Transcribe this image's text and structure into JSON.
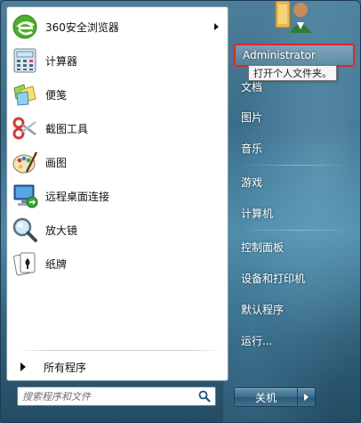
{
  "programs": [
    {
      "label": "360安全浏览器",
      "icon": "browser-icon",
      "has_submenu": true
    },
    {
      "label": "计算器",
      "icon": "calculator-icon"
    },
    {
      "label": "便笺",
      "icon": "sticky-notes-icon"
    },
    {
      "label": "截图工具",
      "icon": "snipping-tool-icon"
    },
    {
      "label": "画图",
      "icon": "paint-icon"
    },
    {
      "label": "远程桌面连接",
      "icon": "remote-desktop-icon"
    },
    {
      "label": "放大镜",
      "icon": "magnifier-icon"
    },
    {
      "label": "纸牌",
      "icon": "solitaire-icon"
    }
  ],
  "all_programs_label": "所有程序",
  "search": {
    "placeholder": "搜索程序和文件"
  },
  "right": {
    "user_name": "Administrator",
    "tooltip": "打开个人文件夹。",
    "items": [
      "文档",
      "图片",
      "音乐",
      "游戏",
      "计算机",
      "控制面板",
      "设备和打印机",
      "默认程序",
      "运行..."
    ]
  },
  "shutdown_label": "关机",
  "colors": {
    "highlight_border": "#e0262b",
    "panel": "#3a6b87"
  }
}
